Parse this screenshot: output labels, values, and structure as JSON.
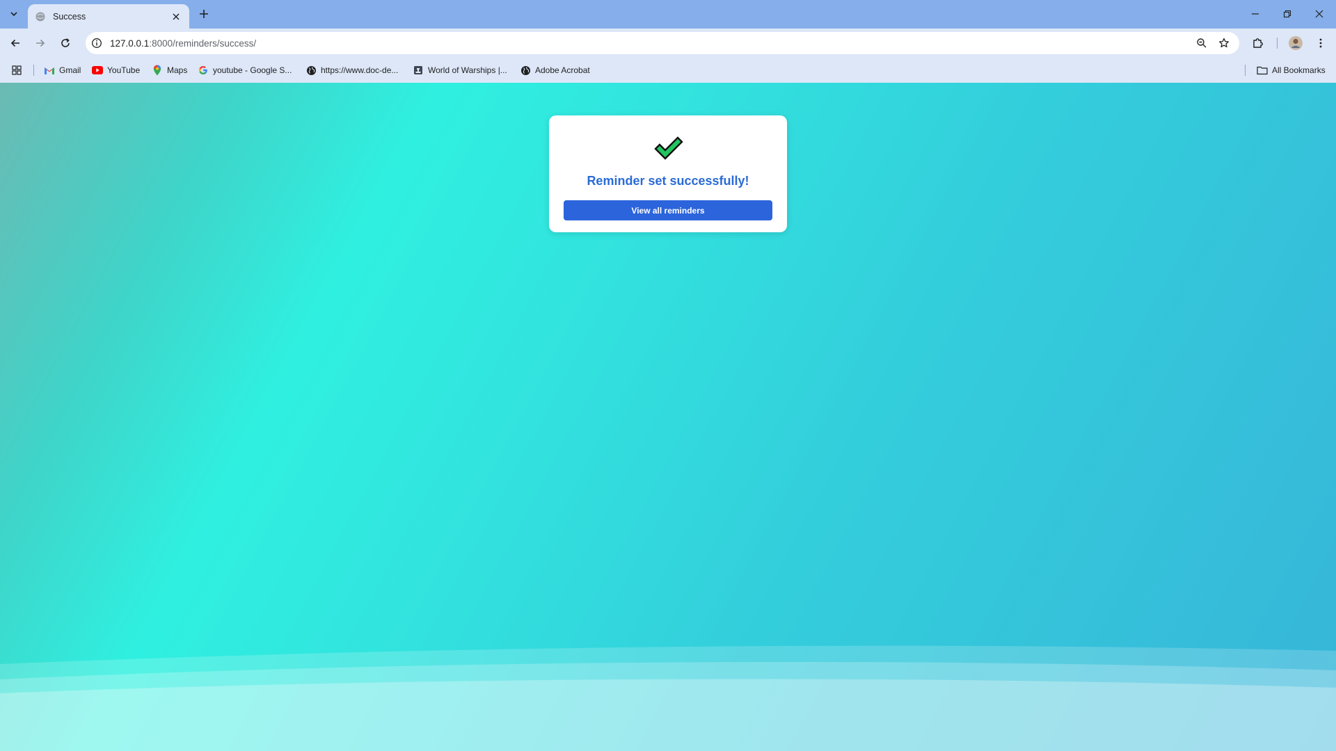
{
  "browser": {
    "tab": {
      "title": "Success"
    },
    "address_bar": {
      "host": "127.0.0.1",
      "path": ":8000/reminders/success/"
    },
    "bookmarks": [
      {
        "label": "Gmail",
        "icon": "gmail-icon"
      },
      {
        "label": "YouTube",
        "icon": "youtube-icon"
      },
      {
        "label": "Maps",
        "icon": "maps-icon"
      },
      {
        "label": "youtube - Google S...",
        "icon": "google-icon"
      },
      {
        "label": "https://www.doc-de...",
        "icon": "globe-icon"
      },
      {
        "label": "World of Warships |...",
        "icon": "warships-icon"
      },
      {
        "label": "Adobe Acrobat",
        "icon": "globe-icon"
      }
    ],
    "all_bookmarks_label": "All Bookmarks"
  },
  "page": {
    "message": "Reminder set successfully!",
    "button_label": "View all reminders"
  },
  "colors": {
    "accent": "#2c64dc",
    "title": "#2a6bd6",
    "check_fill": "#22c55e",
    "background_start": "#2ff0e0",
    "background_end": "#37b5d8"
  }
}
